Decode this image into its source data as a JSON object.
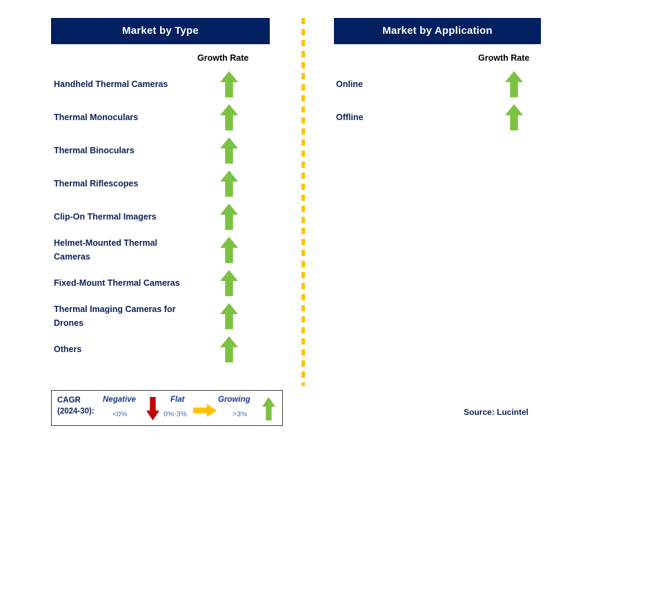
{
  "panels": [
    {
      "id": "type",
      "title": "Market by Type",
      "growth_rate_header": "Growth Rate",
      "rows": [
        {
          "label": "Handheld Thermal Cameras",
          "growth": "growing",
          "icon": "up-arrow-icon"
        },
        {
          "label": "Thermal Monoculars",
          "growth": "growing",
          "icon": "up-arrow-icon"
        },
        {
          "label": "Thermal Binoculars",
          "growth": "growing",
          "icon": "up-arrow-icon"
        },
        {
          "label": "Thermal Riflescopes",
          "growth": "growing",
          "icon": "up-arrow-icon"
        },
        {
          "label": "Clip-On Thermal Imagers",
          "growth": "growing",
          "icon": "up-arrow-icon"
        },
        {
          "label": "Helmet-Mounted Thermal Cameras",
          "growth": "growing",
          "icon": "up-arrow-icon"
        },
        {
          "label": "Fixed-Mount Thermal Cameras",
          "growth": "growing",
          "icon": "up-arrow-icon"
        },
        {
          "label": "Thermal Imaging Cameras for Drones",
          "growth": "growing",
          "icon": "up-arrow-icon"
        },
        {
          "label": "Others",
          "growth": "growing",
          "icon": "up-arrow-icon"
        }
      ]
    },
    {
      "id": "application",
      "title": "Market by Application",
      "growth_rate_header": "Growth Rate",
      "rows": [
        {
          "label": "Online",
          "growth": "growing",
          "icon": "up-arrow-icon"
        },
        {
          "label": "Offline",
          "growth": "growing",
          "icon": "up-arrow-icon"
        }
      ]
    }
  ],
  "legend": {
    "title_line1": "CAGR",
    "title_line2": "(2024-30):",
    "items": [
      {
        "word": "Negative",
        "range": "<0%",
        "icon": "down-arrow-icon",
        "color": "#C00000"
      },
      {
        "word": "Flat",
        "range": "0%-3%",
        "icon": "right-arrow-icon",
        "color": "#FFC000"
      },
      {
        "word": "Growing",
        "range": ">3%",
        "icon": "up-arrow-icon",
        "color": "#7CC242"
      }
    ]
  },
  "source": "Source: Lucintel",
  "colors": {
    "header_bar": "#012060",
    "label_text": "#0D2257",
    "growing": "#7CC242",
    "flat": "#FFC000",
    "negative": "#C00000",
    "divider": "#FFC000"
  },
  "chart_data": {
    "type": "table",
    "title": "Thermal Imaging Market Growth Rate by Segment",
    "legend_position": "bottom-left",
    "categories_axis": "segment",
    "value_axis": "Growth Rate (CAGR 2024-30)",
    "series": [
      {
        "name": "Market by Type",
        "categories": [
          "Handheld Thermal Cameras",
          "Thermal Monoculars",
          "Thermal Binoculars",
          "Thermal Riflescopes",
          "Clip-On Thermal Imagers",
          "Helmet-Mounted Thermal Cameras",
          "Fixed-Mount Thermal Cameras",
          "Thermal Imaging Cameras for Drones",
          "Others"
        ],
        "values": [
          "growing",
          "growing",
          "growing",
          "growing",
          "growing",
          "growing",
          "growing",
          "growing",
          "growing"
        ]
      },
      {
        "name": "Market by Application",
        "categories": [
          "Online",
          "Offline"
        ],
        "values": [
          "growing",
          "growing"
        ]
      }
    ],
    "value_scale": [
      {
        "key": "negative",
        "label": "Negative",
        "range": "<0%"
      },
      {
        "key": "flat",
        "label": "Flat",
        "range": "0%-3%"
      },
      {
        "key": "growing",
        "label": "Growing",
        "range": ">3%"
      }
    ]
  }
}
